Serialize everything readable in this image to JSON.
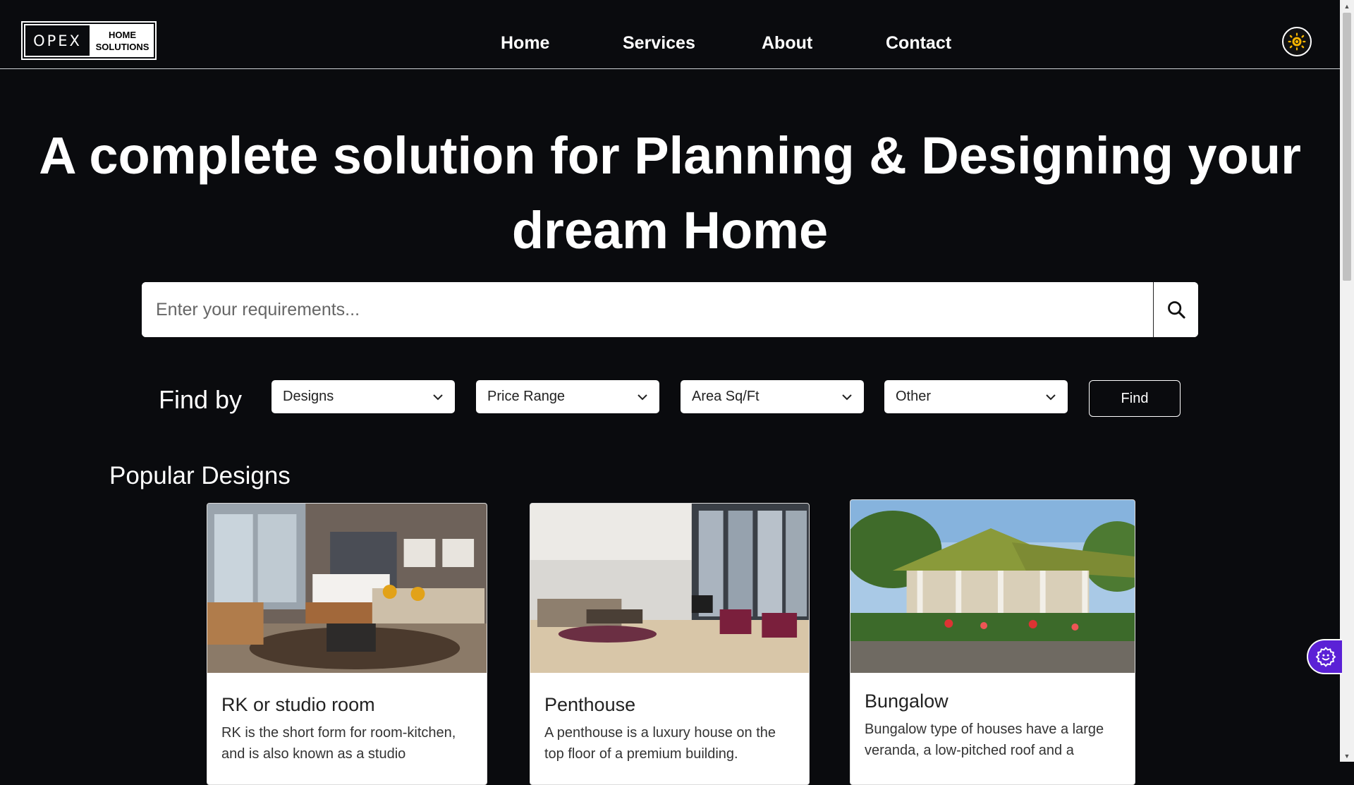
{
  "brand": {
    "logo_main": "OPEX",
    "logo_sub_line1": "HOME",
    "logo_sub_line2": "SOLUTIONS"
  },
  "nav": {
    "items": [
      "Home",
      "Services",
      "About",
      "Contact"
    ]
  },
  "theme_toggle": {
    "icon": "sun-icon",
    "color": "#f5b400"
  },
  "hero": {
    "title": "A complete solution for Planning & Designing your dream Home"
  },
  "search": {
    "placeholder": "Enter your requirements...",
    "icon": "search-icon"
  },
  "filters": {
    "label": "Find by",
    "selects": [
      "Designs",
      "Price Range",
      "Area Sq/Ft",
      "Other"
    ],
    "button": "Find"
  },
  "popular": {
    "title": "Popular Designs",
    "cards": [
      {
        "title": "RK or studio room",
        "text": "RK is the short form for room-kitchen, and is also known as a studio"
      },
      {
        "title": "Penthouse",
        "text": "A penthouse is a luxury house on the top floor of a premium building."
      },
      {
        "title": "Bungalow",
        "text": "Bungalow type of houses have a large veranda, a low-pitched roof and a"
      }
    ]
  },
  "accessibility_widget": {
    "icon": "accessibility-gear-icon",
    "color": "#5b21d6"
  }
}
